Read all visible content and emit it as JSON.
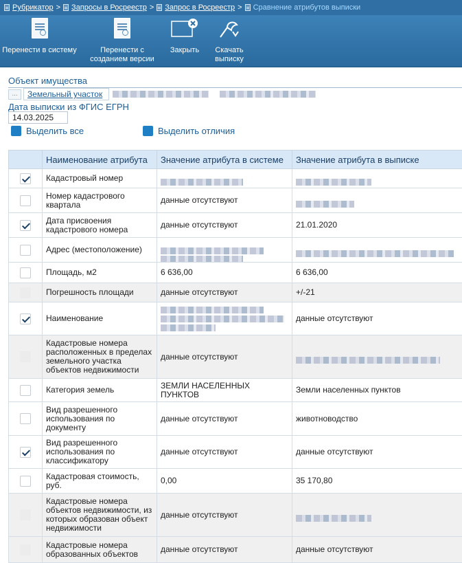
{
  "breadcrumb": {
    "items": [
      "Рубрикатор",
      "Запросы в Росреестр",
      "Запрос в Росреестр"
    ],
    "current": "Сравнение атрибутов выписки",
    "separator": ">"
  },
  "toolbar": {
    "transfer_label": "Перенести в систему",
    "transfer_version_label": "Перенести с созданием версии",
    "close_label": "Закрыть",
    "download_label": "Скачать выписку"
  },
  "form": {
    "object_label": "Объект имущества",
    "object_ellipsis": "...",
    "object_link": "Земельный участок",
    "extract_date_label": "Дата выписки из ФГИС ЕГРН",
    "extract_date_value": "14.03.2025",
    "select_all_label": "Выделить все",
    "select_diff_label": "Выделить отличия"
  },
  "table": {
    "headers": [
      "Наименование атрибута",
      "Значение атрибута в системе",
      "Значение атрибута в выписке"
    ],
    "rows": [
      {
        "name": "Кадастровый номер",
        "system": "",
        "extract": "",
        "checked": true,
        "disabled": false
      },
      {
        "name": "Номер кадастрового квартала",
        "system": "данные отсутствуют",
        "extract": "",
        "checked": false,
        "disabled": false
      },
      {
        "name": "Дата присвоения кадастрового номера",
        "system": "данные отсутствуют",
        "extract": "21.01.2020",
        "checked": true,
        "disabled": false
      },
      {
        "name": "Адрес (местоположение)",
        "system": "",
        "extract": "",
        "checked": false,
        "disabled": false
      },
      {
        "name": "Площадь, м2",
        "system": "6 636,00",
        "extract": "6 636,00",
        "checked": false,
        "disabled": false
      },
      {
        "name": "Погрешность площади",
        "system": "данные отсутствуют",
        "extract": "+/-21",
        "checked": false,
        "disabled": true
      },
      {
        "name": "Наименование",
        "system": "",
        "extract": "данные отсутствуют",
        "checked": true,
        "disabled": false
      },
      {
        "name": "Кадастровые номера расположенных в пределах земельного участка объектов недвижимости",
        "system": "данные отсутствуют",
        "extract": "",
        "checked": false,
        "disabled": true
      },
      {
        "name": "Категория земель",
        "system": "ЗЕМЛИ НАСЕЛЕННЫХ ПУНКТОВ",
        "extract": "Земли населенных пунктов",
        "checked": false,
        "disabled": false
      },
      {
        "name": "Вид разрешенного использования по документу",
        "system": "данные отсутствуют",
        "extract": "животноводство",
        "checked": false,
        "disabled": false
      },
      {
        "name": "Вид разрешенного использования по классификатору",
        "system": "данные отсутствуют",
        "extract": "данные отсутствуют",
        "checked": true,
        "disabled": false
      },
      {
        "name": "Кадастровая стоимость, руб.",
        "system": "0,00",
        "extract": "35 170,80",
        "checked": false,
        "disabled": false
      },
      {
        "name": "Кадастровые номера объектов недвижимости, из которых образован объект недвижимости",
        "system": "данные отсутствуют",
        "extract": "",
        "checked": false,
        "disabled": true
      },
      {
        "name": "Кадастровые номера образованных объектов",
        "system": "данные отсутствуют",
        "extract": "данные отсутствуют",
        "checked": false,
        "disabled": true
      }
    ]
  }
}
